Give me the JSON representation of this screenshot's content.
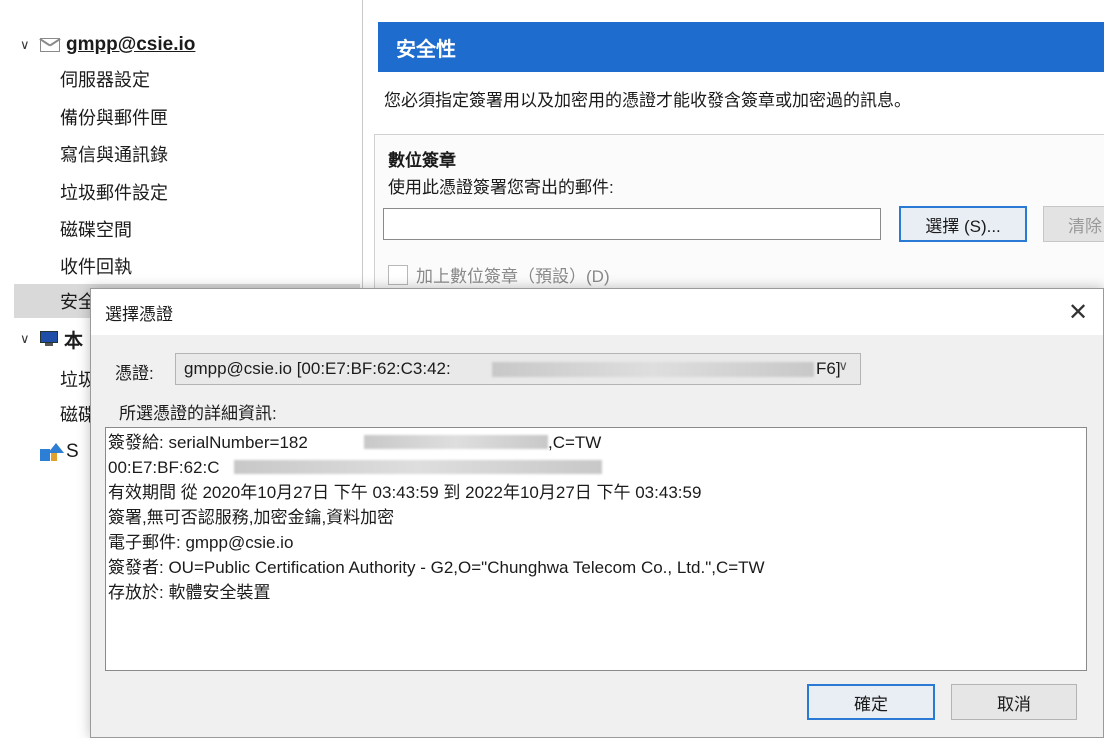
{
  "tree": {
    "account": "gmpp@csie.io",
    "items": [
      "伺服器設定",
      "備份與郵件匣",
      "寫信與通訊錄",
      "垃圾郵件設定",
      "磁碟空間",
      "收件回執",
      "安全性"
    ],
    "local_folder": "本",
    "local_items": [
      "垃圾",
      "磁碟"
    ],
    "s_item": "S"
  },
  "security": {
    "title": "安全性",
    "description": "您必須指定簽署用以及加密用的憑證才能收發含簽章或加密過的訊息。",
    "section_title": "數位簽章",
    "section_sub": "使用此憑證簽署您寄出的郵件:",
    "select_button": "選擇 (S)...",
    "clear_button": "清除",
    "add_signature": "加上數位簽章（預設）(D)"
  },
  "dialog": {
    "title": "選擇憑證",
    "cert_label": "憑證:",
    "cert_value": "gmpp@csie.io [00:E7:BF:62:C3:42:",
    "cert_value_end": "F6]",
    "details_label": "所選憑證的詳細資訊:",
    "details": [
      "簽發給: serialNumber=182",
      " 00:E7:BF:62:C",
      " 有效期間 從 2020年10月27日 下午 03:43:59 到 2022年10月27日 下午 03:43:59",
      " 簽署,無可否認服務,加密金鑰,資料加密",
      " 電子郵件: gmpp@csie.io",
      "簽發者: OU=Public Certification Authority - G2,O=\"Chunghwa Telecom Co., Ltd.\",C=TW",
      "存放於: 軟體安全裝置"
    ],
    "details_line1_end": ",C=TW",
    "ok_button": "確定",
    "cancel_button": "取消"
  }
}
